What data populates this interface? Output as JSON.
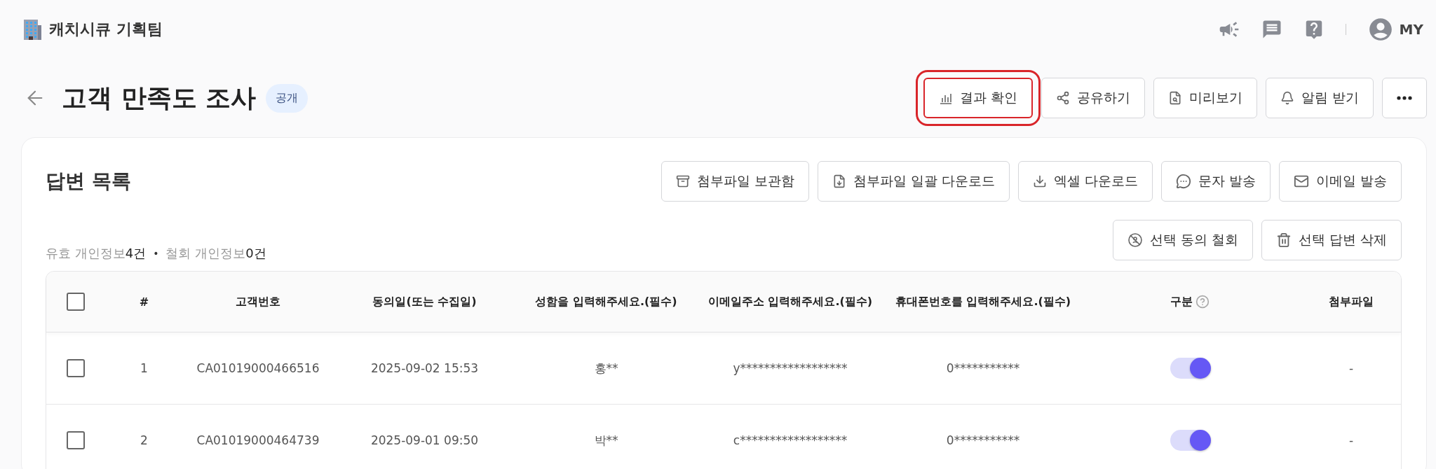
{
  "header": {
    "team_name": "캐치시큐 기획팀",
    "user_label": "MY"
  },
  "page": {
    "title": "고객 만족도 조사",
    "badge": "공개",
    "actions": [
      {
        "kind": "chart",
        "label": "결과 확인",
        "highlighted": true
      },
      {
        "kind": "share",
        "label": "공유하기",
        "highlighted": false
      },
      {
        "kind": "preview",
        "label": "미리보기",
        "highlighted": false
      },
      {
        "kind": "bell",
        "label": "알림 받기",
        "highlighted": false
      },
      {
        "kind": "more",
        "highlighted": false
      }
    ]
  },
  "answers": {
    "title": "답변 목록",
    "actions": [
      {
        "kind": "archive",
        "label": "첨부파일 보관함"
      },
      {
        "kind": "file-download",
        "label": "첨부파일 일괄 다운로드"
      },
      {
        "kind": "download",
        "label": "엑셀 다운로드"
      },
      {
        "kind": "message",
        "label": "문자 발송"
      },
      {
        "kind": "mail",
        "label": "이메일 발송"
      }
    ],
    "stats": [
      {
        "label": "유효 개인정보",
        "count": "4건"
      },
      {
        "label": "철회 개인정보",
        "count": "0건"
      }
    ],
    "separator": "•",
    "selection_actions": [
      {
        "kind": "revoke",
        "label": "선택 동의 철회"
      },
      {
        "kind": "trash",
        "label": "선택 답변 삭제"
      }
    ],
    "table": {
      "select_all": {
        "checked": false
      },
      "columns": [
        {
          "label": "#"
        },
        {
          "label": "고객번호"
        },
        {
          "label": "동의일(또는 수집일)"
        },
        {
          "label": "성함을 입력해주세요.(필수)"
        },
        {
          "label": "이메일주소 입력해주세요.(필수)"
        },
        {
          "label": "휴대폰번호를 입력해주세요.(필수)"
        },
        {
          "label": "구분",
          "help": true
        },
        {
          "label": "첨부파일"
        }
      ],
      "rows": [
        {
          "checked": false,
          "cells": [
            "1",
            "CA01019000466516",
            "2025-09-02 15:53",
            "홍**",
            "y******************",
            "0***********"
          ],
          "on": true,
          "attachment": "-"
        },
        {
          "checked": false,
          "cells": [
            "2",
            "CA01019000464739",
            "2025-09-01 09:50",
            "박**",
            "c******************",
            "0***********"
          ],
          "on": true,
          "attachment": "-"
        }
      ]
    }
  }
}
